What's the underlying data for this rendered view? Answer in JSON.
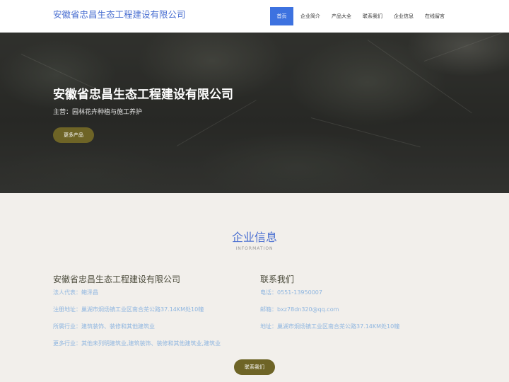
{
  "header": {
    "brand": "安徽省忠昌生态工程建设有限公司",
    "nav": [
      {
        "label": "首页",
        "active": true
      },
      {
        "label": "企业简介"
      },
      {
        "label": "产品大全"
      },
      {
        "label": "联系我们"
      },
      {
        "label": "企业信息"
      },
      {
        "label": "在线留言"
      }
    ]
  },
  "hero": {
    "title": "安徽省忠昌生态工程建设有限公司",
    "subtitle": "主营：园林花卉种植与施工养护",
    "button": "更多产品"
  },
  "info": {
    "title": "企业信息",
    "subtitle": "INFORMATION",
    "company": {
      "title": "安徽省忠昌生态工程建设有限公司",
      "lines": [
        "法人代表：鲍泽昌",
        "注册地址：巢湖市烔炀镇工业区南合芜公路37.14KM处10幢",
        "所属行业：建筑装饰、装修和其他建筑业",
        "更多行业：其他未列明建筑业,建筑装饰、装修和其他建筑业,建筑业"
      ]
    },
    "contact": {
      "title": "联系我们",
      "lines": [
        "电话：0551-13950007",
        "邮箱：bxz78dn320@qq.com",
        "地址：巢湖市烔炀镇工业区南合芜公路37.14KM处10幢"
      ]
    },
    "button": "联系我们"
  }
}
